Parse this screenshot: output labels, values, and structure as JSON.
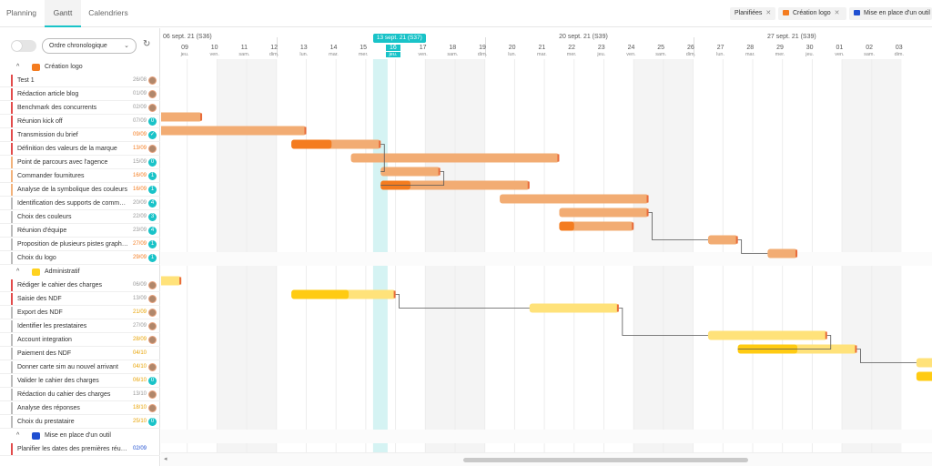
{
  "tabs": [
    "Planning",
    "Gantt",
    "Calendriers"
  ],
  "active_tab": 1,
  "filters": [
    {
      "label": "Planifiées",
      "color": ""
    },
    {
      "label": "Création logo",
      "color": "#f47c20"
    },
    {
      "label": "Mise en place d'un outil",
      "color": "#1f4fd1"
    }
  ],
  "controls": {
    "sort_select": "Ordre chronologique"
  },
  "groups": [
    {
      "name": "Création logo",
      "color": "#f47c20",
      "tasks": [
        {
          "name": "Test 1",
          "date": "26/08",
          "bar": "#e24b4b",
          "date_color": "#999",
          "av": "photo"
        },
        {
          "name": "Rédaction article blog",
          "date": "01/09",
          "bar": "#e24b4b",
          "date_color": "#999",
          "av": "photo"
        },
        {
          "name": "Benchmark des concurrents",
          "date": "02/09",
          "bar": "#e24b4b",
          "date_color": "#999",
          "av": "photo"
        },
        {
          "name": "Réunion kick off",
          "date": "07/09",
          "bar": "#e24b4b",
          "date_color": "#999",
          "av": "0"
        },
        {
          "name": "Transmission du brief",
          "date": "09/09",
          "bar": "#e24b4b",
          "date_color": "#f47c20",
          "av": "check"
        },
        {
          "name": "Définition des valeurs de la marque",
          "date": "13/09",
          "bar": "#e24b4b",
          "date_color": "#f47c20",
          "av": "photo"
        },
        {
          "name": "Point de parcours avec l'agence",
          "date": "15/09",
          "bar": "#f2b27b",
          "date_color": "#999",
          "av": "0"
        },
        {
          "name": "Commander fournitures",
          "date": "16/09",
          "bar": "#f2b27b",
          "date_color": "#f47c20",
          "av": "1"
        },
        {
          "name": "Analyse de la symbolique des couleurs",
          "date": "16/09",
          "bar": "#f2b27b",
          "date_color": "#f47c20",
          "av": "1"
        },
        {
          "name": "Identification des supports de commun...",
          "date": "20/09",
          "bar": "#bbbbbb",
          "date_color": "#999",
          "av": "4"
        },
        {
          "name": "Choix des couleurs",
          "date": "22/09",
          "bar": "#bbbbbb",
          "date_color": "#999",
          "av": "3"
        },
        {
          "name": "Réunion d'équipe",
          "date": "23/09",
          "bar": "#bbbbbb",
          "date_color": "#999",
          "av": "4"
        },
        {
          "name": "Proposition de plusieurs pistes graphiq...",
          "date": "27/09",
          "bar": "#bbbbbb",
          "date_color": "#f47c20",
          "av": "1"
        },
        {
          "name": "Choix du logo",
          "date": "29/09",
          "bar": "#bbbbbb",
          "date_color": "#f47c20",
          "av": "1"
        }
      ]
    },
    {
      "name": "Administratif",
      "color": "#ffd21f",
      "tasks": [
        {
          "name": "Rédiger le cahier des charges",
          "date": "06/09",
          "bar": "#e24b4b",
          "date_color": "#999",
          "av": "photo"
        },
        {
          "name": "Saisie des NDF",
          "date": "13/09",
          "bar": "#e24b4b",
          "date_color": "#999",
          "av": "photo"
        },
        {
          "name": "Export des NDF",
          "date": "21/09",
          "bar": "#bbbbbb",
          "date_color": "#e8a200",
          "av": "photo"
        },
        {
          "name": "Identifier les prestataires",
          "date": "27/09",
          "bar": "#bbbbbb",
          "date_color": "#999",
          "av": "photo"
        },
        {
          "name": "Account integration",
          "date": "28/09",
          "bar": "#bbbbbb",
          "date_color": "#e8a200",
          "av": "photo"
        },
        {
          "name": "Paiement des NDF",
          "date": "04/10",
          "bar": "#bbbbbb",
          "date_color": "#e8a200",
          "av": ""
        },
        {
          "name": "Donner carte sim au nouvel arrivant",
          "date": "04/10",
          "bar": "#bbbbbb",
          "date_color": "#e8a200",
          "av": "photo"
        },
        {
          "name": "Valider le cahier des charges",
          "date": "06/10",
          "bar": "#bbbbbb",
          "date_color": "#e8a200",
          "av": "0"
        },
        {
          "name": "Rédaction du cahier des charges",
          "date": "13/10",
          "bar": "#bbbbbb",
          "date_color": "#999",
          "av": "photo"
        },
        {
          "name": "Analyse des réponses",
          "date": "18/10",
          "bar": "#bbbbbb",
          "date_color": "#e8a200",
          "av": "photo"
        },
        {
          "name": "Choix du prestataire",
          "date": "25/10",
          "bar": "#bbbbbb",
          "date_color": "#e8a200",
          "av": "0"
        }
      ]
    },
    {
      "name": "Mise en place d'un outil",
      "color": "#1f4fd1",
      "tasks": [
        {
          "name": "Planifier les dates des premières réuni...",
          "date": "02/09",
          "bar": "#e24b4b",
          "date_color": "#1f4fd1",
          "av": ""
        }
      ]
    }
  ],
  "timeline": {
    "weeks": [
      "06 sept. 21 (S36)",
      "20 sept. 21 (S39)",
      "27 sept. 21 (S39)"
    ],
    "today_label": "13 sept. 21 (S37)",
    "days": [
      {
        "n": "09",
        "d": "jeu."
      },
      {
        "n": "10",
        "d": "ven."
      },
      {
        "n": "11",
        "d": "sam."
      },
      {
        "n": "12",
        "d": "dim."
      },
      {
        "n": "13",
        "d": "lun."
      },
      {
        "n": "14",
        "d": "mar."
      },
      {
        "n": "15",
        "d": "mer."
      },
      {
        "n": "16",
        "d": "jeu."
      },
      {
        "n": "17",
        "d": "ven."
      },
      {
        "n": "18",
        "d": "sam."
      },
      {
        "n": "19",
        "d": "dim."
      },
      {
        "n": "20",
        "d": "lun."
      },
      {
        "n": "21",
        "d": "mar."
      },
      {
        "n": "22",
        "d": "mer."
      },
      {
        "n": "23",
        "d": "jeu."
      },
      {
        "n": "24",
        "d": "ven."
      },
      {
        "n": "25",
        "d": "sam."
      },
      {
        "n": "26",
        "d": "dim."
      },
      {
        "n": "27",
        "d": "lun."
      },
      {
        "n": "28",
        "d": "mar."
      },
      {
        "n": "29",
        "d": "mer."
      },
      {
        "n": "30",
        "d": "jeu."
      },
      {
        "n": "01",
        "d": "ven."
      },
      {
        "n": "02",
        "d": "sam."
      },
      {
        "n": "03",
        "d": "dim."
      }
    ]
  },
  "bars": [
    {
      "row": 3,
      "start": -1.0,
      "end": 1.5,
      "color": "#f47c20",
      "fill": "#f2ac73",
      "progress": 0.1
    },
    {
      "row": 4,
      "start": 0.0,
      "end": 5.0,
      "color": "#f2ac73",
      "fill": "#f2ac73",
      "progress": 0
    },
    {
      "row": 5,
      "start": 4.5,
      "end": 7.5,
      "color": "#f47c20",
      "fill": "#f2ac73",
      "progress": 0.45
    },
    {
      "row": 6,
      "start": 6.5,
      "end": 13.5,
      "color": "#f2ac73",
      "fill": "#f2ac73",
      "progress": 0
    },
    {
      "row": 7,
      "start": 7.5,
      "end": 9.5,
      "color": "#f2ac73",
      "fill": "#f2ac73",
      "progress": 0
    },
    {
      "row": 8,
      "start": 7.5,
      "end": 12.5,
      "color": "#f47c20",
      "fill": "#f2ac73",
      "progress": 0.2
    },
    {
      "row": 9,
      "start": 11.5,
      "end": 16.5,
      "color": "#f2ac73",
      "fill": "#f2ac73",
      "progress": 0
    },
    {
      "row": 10,
      "start": 13.5,
      "end": 16.5,
      "color": "#f2ac73",
      "fill": "#f2ac73",
      "progress": 0
    },
    {
      "row": 11,
      "start": 13.5,
      "end": 16.0,
      "color": "#f47c20",
      "fill": "#f2ac73",
      "progress": 0.2
    },
    {
      "row": 12,
      "start": 18.5,
      "end": 19.5,
      "color": "#f2ac73",
      "fill": "#f2ac73",
      "progress": 0
    },
    {
      "row": 13,
      "start": 20.5,
      "end": 21.5,
      "color": "#f2ac73",
      "fill": "#f2ac73",
      "progress": 0
    },
    {
      "row": 15,
      "start": -1.0,
      "end": 0.8,
      "color": "#ffe27a",
      "fill": "#ffe27a",
      "progress": 0
    },
    {
      "row": 16,
      "start": 4.5,
      "end": 8.0,
      "color": "#ffcb12",
      "fill": "#ffe27a",
      "progress": 0.55
    },
    {
      "row": 17,
      "start": 12.5,
      "end": 15.5,
      "color": "#ffe27a",
      "fill": "#ffe27a",
      "progress": 0
    },
    {
      "row": 19,
      "start": 18.5,
      "end": 22.5,
      "color": "#ffe27a",
      "fill": "#ffe27a",
      "progress": 0
    },
    {
      "row": 20,
      "start": 19.5,
      "end": 23.5,
      "color": "#ffcb12",
      "fill": "#ffe27a",
      "progress": 0.5
    },
    {
      "row": 21,
      "start": 25.5,
      "end": 27.0,
      "color": "#ffe27a",
      "fill": "#ffe27a",
      "progress": 0
    },
    {
      "row": 22,
      "start": 25.5,
      "end": 27.0,
      "color": "#ffcb12",
      "fill": "#ffcb12",
      "progress": 0
    }
  ]
}
